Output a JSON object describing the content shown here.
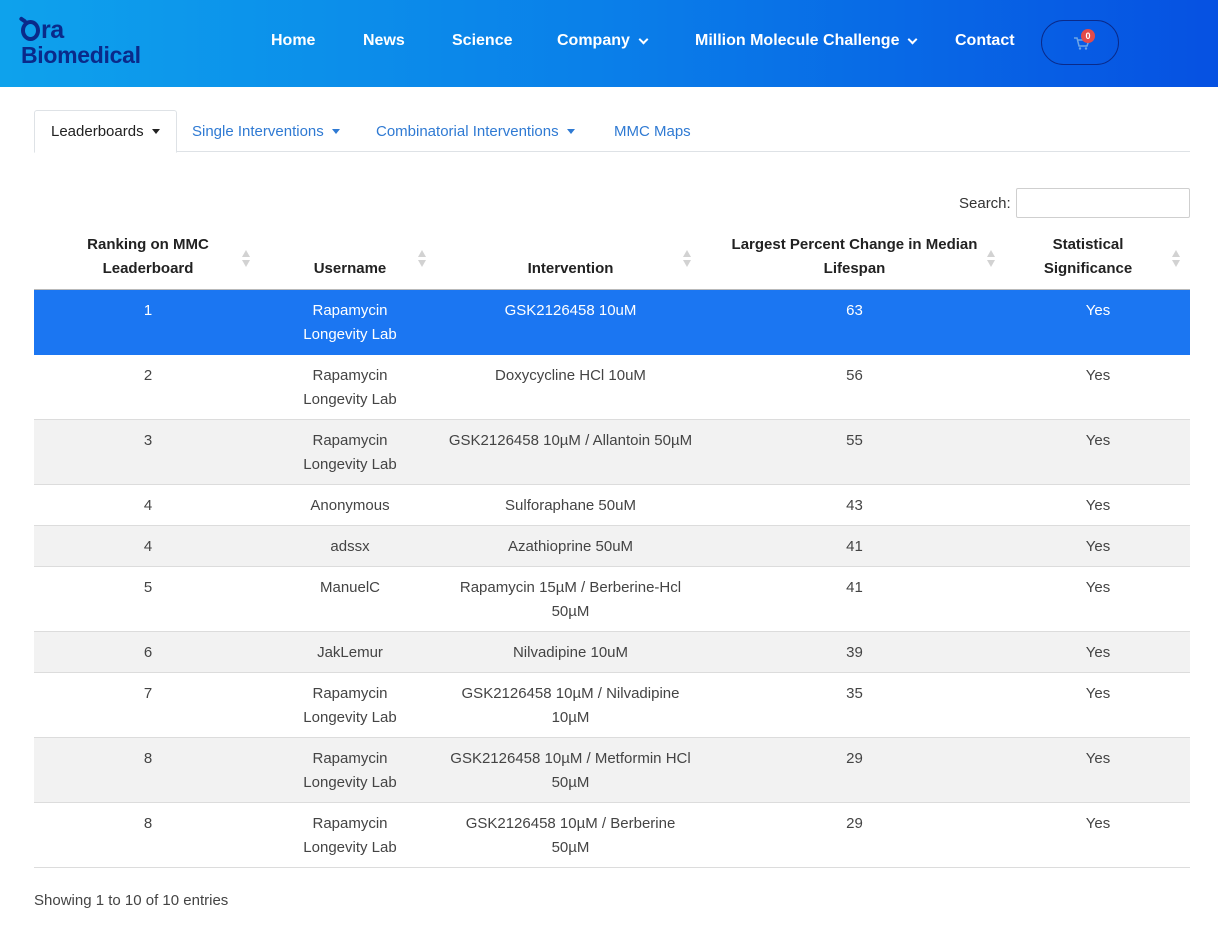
{
  "header": {
    "logo_line1": "Ora",
    "logo_line2": "Biomedical",
    "nav": [
      "Home",
      "News",
      "Science",
      "Company",
      "Million Molecule Challenge",
      "Contact"
    ],
    "cart_count": "0",
    "colors": {
      "gradient_start": "#0ea2ec",
      "gradient_end": "#0651e2",
      "logo": "#0a2a8a",
      "badge": "#e24b4b"
    }
  },
  "tabs": [
    "Leaderboards",
    "Single Interventions",
    "Combinatorial Interventions",
    "MMC Maps"
  ],
  "search": {
    "label": "Search:",
    "value": "",
    "placeholder": ""
  },
  "table": {
    "headers": [
      "Ranking on MMC Leaderboard",
      "Username",
      "Intervention",
      "Largest Percent Change in Median Lifespan",
      "Statistical Significance"
    ],
    "rows": [
      {
        "rank": "1",
        "user": "Rapamycin Longevity Lab",
        "intervention": "GSK2126458 10uM",
        "pct": "63",
        "sig": "Yes"
      },
      {
        "rank": "2",
        "user": "Rapamycin Longevity Lab",
        "intervention": "Doxycycline HCl 10uM",
        "pct": "56",
        "sig": "Yes"
      },
      {
        "rank": "3",
        "user": "Rapamycin Longevity Lab",
        "intervention": "GSK2126458 10µM / Allantoin 50µM",
        "pct": "55",
        "sig": "Yes"
      },
      {
        "rank": "4",
        "user": "Anonymous",
        "intervention": "Sulforaphane 50uM",
        "pct": "43",
        "sig": "Yes"
      },
      {
        "rank": "4",
        "user": "adssx",
        "intervention": "Azathioprine 50uM",
        "pct": "41",
        "sig": "Yes"
      },
      {
        "rank": "5",
        "user": "ManuelC",
        "intervention": "Rapamycin 15µM / Berberine-Hcl 50µM",
        "pct": "41",
        "sig": "Yes"
      },
      {
        "rank": "6",
        "user": "JakLemur",
        "intervention": "Nilvadipine 10uM",
        "pct": "39",
        "sig": "Yes"
      },
      {
        "rank": "7",
        "user": "Rapamycin Longevity Lab",
        "intervention": "GSK2126458 10µM / Nilvadipine 10µM",
        "pct": "35",
        "sig": "Yes"
      },
      {
        "rank": "8",
        "user": "Rapamycin Longevity Lab",
        "intervention": "GSK2126458 10µM / Metformin HCl 50µM",
        "pct": "29",
        "sig": "Yes"
      },
      {
        "rank": "8",
        "user": "Rapamycin Longevity Lab",
        "intervention": "GSK2126458 10µM / Berberine 50µM",
        "pct": "29",
        "sig": "Yes"
      }
    ],
    "selected_row_color": "#1b76f2"
  },
  "info": "Showing 1 to 10 of 10 entries"
}
